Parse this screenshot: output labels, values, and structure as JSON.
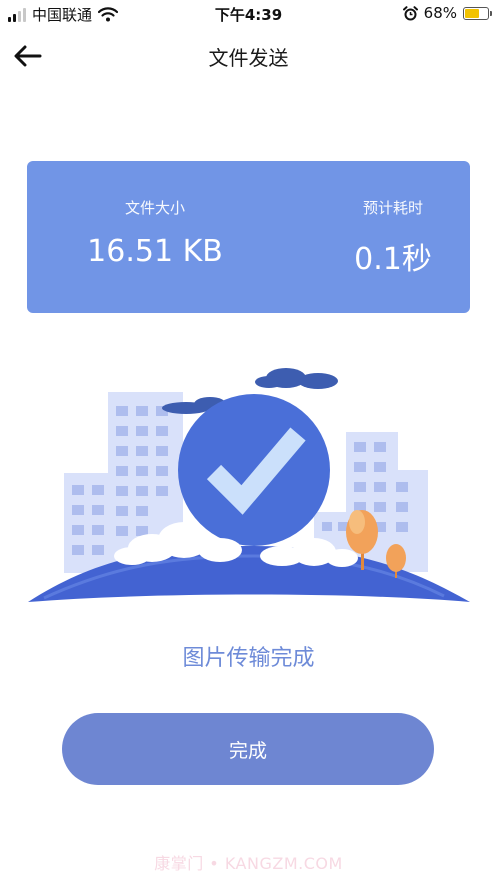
{
  "status_bar": {
    "carrier": "中国联通",
    "time": "下午4:39",
    "battery_percent": "68%",
    "battery_level": 0.68,
    "icons": [
      "signal-icon",
      "wifi-icon",
      "alarm-icon",
      "battery-icon"
    ]
  },
  "nav": {
    "title": "文件发送",
    "back_icon": "arrow-left-icon"
  },
  "info": {
    "size_label": "文件大小",
    "size_value": "16.51 KB",
    "time_label": "预计耗时",
    "time_value": "0.1秒"
  },
  "result": {
    "message": "图片传输完成"
  },
  "actions": {
    "done_label": "完成"
  },
  "watermark": "康掌门 • KANGZM.COM",
  "colors": {
    "card": "#7195e6",
    "button": "#6e86d2",
    "accent_text": "#6e8bd8",
    "check_circle": "#4a6fd8",
    "buildings": "#dbe3fb",
    "tree": "#f2a25a"
  }
}
